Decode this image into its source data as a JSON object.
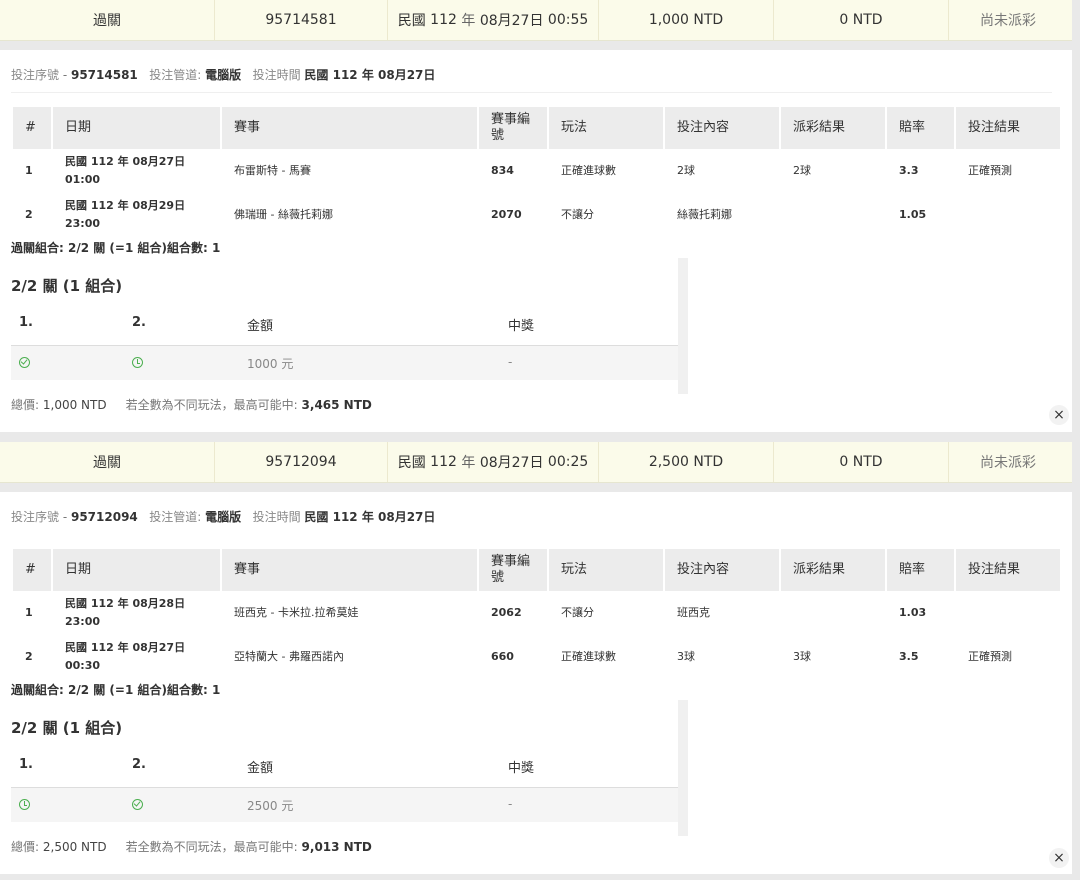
{
  "orders": [
    {
      "summary": {
        "type": "過關",
        "serial": "95714581",
        "date_prefix": "民國",
        "year": "112",
        "year_unit": "年",
        "md": "08月27日",
        "time": "00:55",
        "stake": "1,000 NTD",
        "payout": "0 NTD",
        "status": "尚未派彩"
      },
      "meta": {
        "serial_label": "投注序號",
        "serial": "95714581",
        "channel_label": "投注管道:",
        "channel": "電腦版",
        "time_label": "投注時間",
        "time": "民國 112 年 08月27日"
      },
      "headers": [
        "#",
        "日期",
        "賽事",
        "賽事編號",
        "玩法",
        "投注內容",
        "派彩結果",
        "賠率",
        "投注結果"
      ],
      "rows": [
        {
          "idx": "1",
          "date1": "民國 112 年 08月27日",
          "date2": "01:00",
          "match": "布雷斯特 - 馬賽",
          "code": "834",
          "play": "正確進球數",
          "bet": "2球",
          "result": "2球",
          "odds": "3.3",
          "outcome": "正確預測"
        },
        {
          "idx": "2",
          "date1": "民國 112 年 08月29日",
          "date2": "23:00",
          "match": "佛瑞珊 - 絲薇托莉娜",
          "code": "2070",
          "play": "不讓分",
          "bet": "絲薇托莉娜",
          "result": "",
          "odds": "1.05",
          "outcome": ""
        }
      ],
      "combo_line": "過關組合: 2/2 關 (=1 組合)組合數: 1",
      "combo_title": "2/2 關 (1 組合)",
      "combo_headers": {
        "c1": "1.",
        "c2": "2.",
        "amount": "金額",
        "prize": "中獎"
      },
      "combo_row": {
        "icon1": "check-circle-icon",
        "icon2": "clock-icon",
        "amount": "1000 元",
        "prize": "-"
      },
      "total": {
        "label": "總價:",
        "value": "1,000 NTD",
        "note": "若全數為不同玩法，最高可能中:",
        "max": "3,465 NTD"
      },
      "close": "×"
    },
    {
      "summary": {
        "type": "過關",
        "serial": "95712094",
        "date_prefix": "民國",
        "year": "112",
        "year_unit": "年",
        "md": "08月27日",
        "time": "00:25",
        "stake": "2,500 NTD",
        "payout": "0 NTD",
        "status": "尚未派彩"
      },
      "meta": {
        "serial_label": "投注序號",
        "serial": "95712094",
        "channel_label": "投注管道:",
        "channel": "電腦版",
        "time_label": "投注時間",
        "time": "民國 112 年 08月27日"
      },
      "headers": [
        "#",
        "日期",
        "賽事",
        "賽事編號",
        "玩法",
        "投注內容",
        "派彩結果",
        "賠率",
        "投注結果"
      ],
      "rows": [
        {
          "idx": "1",
          "date1": "民國 112 年 08月28日",
          "date2": "23:00",
          "match": "班西克 - 卡米拉.拉希莫娃",
          "code": "2062",
          "play": "不讓分",
          "bet": "班西克",
          "result": "",
          "odds": "1.03",
          "outcome": ""
        },
        {
          "idx": "2",
          "date1": "民國 112 年 08月27日",
          "date2": "00:30",
          "match": "亞特蘭大 - 弗羅西諾內",
          "code": "660",
          "play": "正確進球數",
          "bet": "3球",
          "result": "3球",
          "odds": "3.5",
          "outcome": "正確預測"
        }
      ],
      "combo_line": "過關組合: 2/2 關 (=1 組合)組合數: 1",
      "combo_title": "2/2 關 (1 組合)",
      "combo_headers": {
        "c1": "1.",
        "c2": "2.",
        "amount": "金額",
        "prize": "中獎"
      },
      "combo_row": {
        "icon1": "clock-icon",
        "icon2": "check-circle-icon",
        "amount": "2500 元",
        "prize": "-"
      },
      "total": {
        "label": "總價:",
        "value": "2,500 NTD",
        "note": "若全數為不同玩法，最高可能中:",
        "max": "9,013 NTD"
      },
      "close": "×"
    }
  ]
}
